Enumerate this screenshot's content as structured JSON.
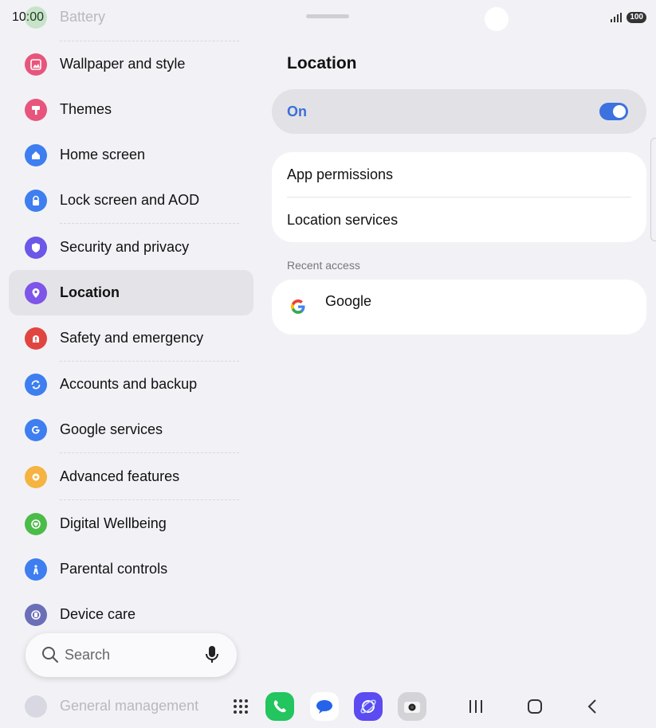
{
  "status": {
    "time": "10:00",
    "battery": "100"
  },
  "sidebar": {
    "top_partial": "Battery",
    "items": [
      {
        "label": "Wallpaper and style",
        "icon": "wallpaper-icon",
        "color": "#e8557c"
      },
      {
        "label": "Themes",
        "icon": "themes-brush-icon",
        "color": "#e8557c"
      },
      {
        "label": "Home screen",
        "icon": "home-icon",
        "color": "#3e7ef0"
      },
      {
        "label": "Lock screen and AOD",
        "icon": "lock-icon",
        "color": "#3e7ef0"
      },
      {
        "label": "Security and privacy",
        "icon": "shield-icon",
        "color": "#6b57e8"
      },
      {
        "label": "Location",
        "icon": "location-pin-icon",
        "color": "#7f54e8"
      },
      {
        "label": "Safety and emergency",
        "icon": "emergency-icon",
        "color": "#e0463f"
      },
      {
        "label": "Accounts and backup",
        "icon": "sync-icon",
        "color": "#3e7ef0"
      },
      {
        "label": "Google services",
        "icon": "google-g-icon",
        "color": "#3e7ef0"
      },
      {
        "label": "Advanced features",
        "icon": "gear-flower-icon",
        "color": "#f5b342"
      },
      {
        "label": "Digital Wellbeing",
        "icon": "heart-circle-icon",
        "color": "#4cbb4a"
      },
      {
        "label": "Parental controls",
        "icon": "parent-child-icon",
        "color": "#3e7ef0"
      },
      {
        "label": "Device care",
        "icon": "device-care-icon",
        "color": "#6b6fb8"
      }
    ],
    "bottom_partial": "General management"
  },
  "search": {
    "label": "Search"
  },
  "main": {
    "title": "Location",
    "toggle": {
      "label": "On",
      "state": "on"
    },
    "rows": [
      "App permissions",
      "Location services"
    ],
    "recent_label": "Recent access",
    "recent_apps": [
      {
        "name": "Google"
      }
    ]
  },
  "colors": {
    "accent": "#3b72e0",
    "selected_bg": "#e4e4e8",
    "background": "#f2f2f6"
  }
}
